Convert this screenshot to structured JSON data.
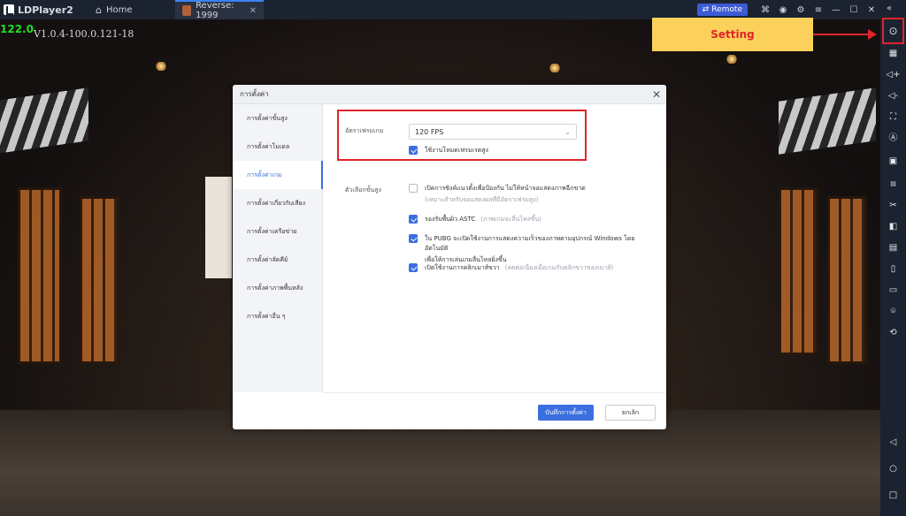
{
  "titlebar": {
    "app_name": "LDPlayer2",
    "tabs": [
      {
        "label": "Home",
        "icon": "home-icon"
      },
      {
        "label": "Reverse: 1999",
        "icon": "game-thumbnail"
      }
    ],
    "remote_label": "Remote",
    "controls": [
      "gamepad-icon",
      "account-icon",
      "settings-icon",
      "menu-icon",
      "minimize-icon",
      "maximize-icon",
      "close-icon",
      "collapse-icon"
    ]
  },
  "overlay": {
    "fps": "122.0",
    "version": "V1.0.4-100.0.121-18"
  },
  "callout": {
    "label": "Setting",
    "color": "#e0242a",
    "background": "#fbd15b"
  },
  "dialog": {
    "title": "การตั้งค่า",
    "nav": [
      {
        "label": "การตั้งค่าขั้นสูง",
        "active": false
      },
      {
        "label": "การตั้งค่าโมเดล",
        "active": false
      },
      {
        "label": "การตั้งค่าเกม",
        "active": true
      },
      {
        "label": "การตั้งค่าเกี่ยวกับเสียง",
        "active": false
      },
      {
        "label": "การตั้งค่าเครือข่าย",
        "active": false
      },
      {
        "label": "การตั้งค่าลัดคีย์",
        "active": false
      },
      {
        "label": "การตั้งค่าภาพพื้นหลัง",
        "active": false
      },
      {
        "label": "การตั้งค่าอื่น ๆ",
        "active": false
      }
    ],
    "game_fps_label": "อัตราเฟรมเกม",
    "fps_select_value": "120 FPS",
    "high_fps_label": "ใช้งานโหมดเฟรมเรตสูง",
    "advanced_label": "ตัวเลือกขั้นสูง",
    "options": [
      {
        "text": "เปิดการซิงค์แนวตั้งเพื่อป้องกัน ไม่ให้หน้าจอแสดงภาพฉีกขาด",
        "sub": "(เหมาะสำหรับจอแสดงผลที่มีอัตราเฟรมสูง)",
        "checked": false
      },
      {
        "text": "รองรับพื้นผิว ASTC",
        "hint": "(ภาพเกมจะลื่นไหลขึ้น)",
        "checked": true
      },
      {
        "text": "ใน PUBG จะเปิดใช้งานการแสดงความเร็วของภาพตามอุปกรณ์ Windows โดยอัตโนมัติ",
        "sub": "เพื่อให้การเล่นเกมลื่นไหลยิ่งขึ้น",
        "checked": true
      },
      {
        "text": "เปิดใช้งานการคลิกเมาส์ขวา",
        "hint": "(ลดต่อเนื่องเมื่อเกมกับคลิกขวาของเมาส์)",
        "checked": true
      }
    ],
    "save_label": "บันทึกการตั้งค่า",
    "cancel_label": "ยกเลิก"
  },
  "sidebar": {
    "icons": [
      "settings-icon",
      "keyboard-icon",
      "volume-up-icon",
      "volume-down-icon",
      "fullscreen-icon",
      "auto-click-icon",
      "screenshot-icon",
      "fps-icon",
      "scissors-icon",
      "multi-instance-icon",
      "apk-icon",
      "shake-icon",
      "folder-icon",
      "location-icon",
      "rotate-icon",
      "back-icon",
      "home-circle-icon",
      "recent-apps-icon"
    ]
  }
}
